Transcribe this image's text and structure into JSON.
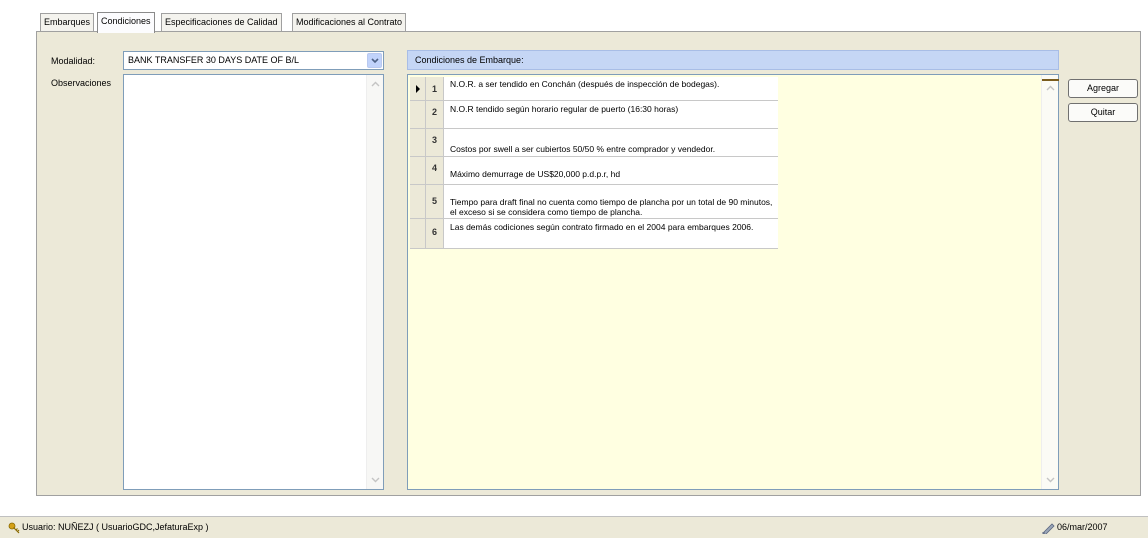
{
  "tabs": [
    "Embarques",
    "Condiciones",
    "Especificaciones de Calidad",
    "Modificaciones al Contrato"
  ],
  "form": {
    "modalidad_label": "Modalidad:",
    "modalidad_value": "BANK TRANSFER 30 DAYS DATE OF B/L",
    "observaciones_label": "Observaciones",
    "observaciones_value": ""
  },
  "conditions": {
    "header": "Condiciones de Embarque:",
    "rows": [
      {
        "num": "1",
        "text": "N.O.R. a ser tendido en Conchán (después de inspección de bodegas)."
      },
      {
        "num": "2",
        "text": "N.O.R tendido según horario regular de puerto (16:30 horas)"
      },
      {
        "num": "3",
        "text": "Costos por swell a ser cubiertos 50/50 % entre comprador y vendedor."
      },
      {
        "num": "4",
        "text": "Máximo demurrage de US$20,000 p.d.p.r, hd"
      },
      {
        "num": "5",
        "text": "Tiempo para draft final no cuenta como tiempo de plancha por un total de 90 minutos, el exceso si se considera como tiempo de plancha."
      },
      {
        "num": "6",
        "text": "Las demás codiciones según contrato firmado en el 2004 para embarques 2006."
      }
    ]
  },
  "buttons": {
    "add": "Agregar",
    "remove": "Quitar"
  },
  "statusbar": {
    "user": "Usuario: NUÑEZJ ( UsuarioGDC,JefaturaExp )",
    "date": "06/mar/2007"
  },
  "icons": {
    "user": "user-keys-icon",
    "date": "pen-icon"
  }
}
